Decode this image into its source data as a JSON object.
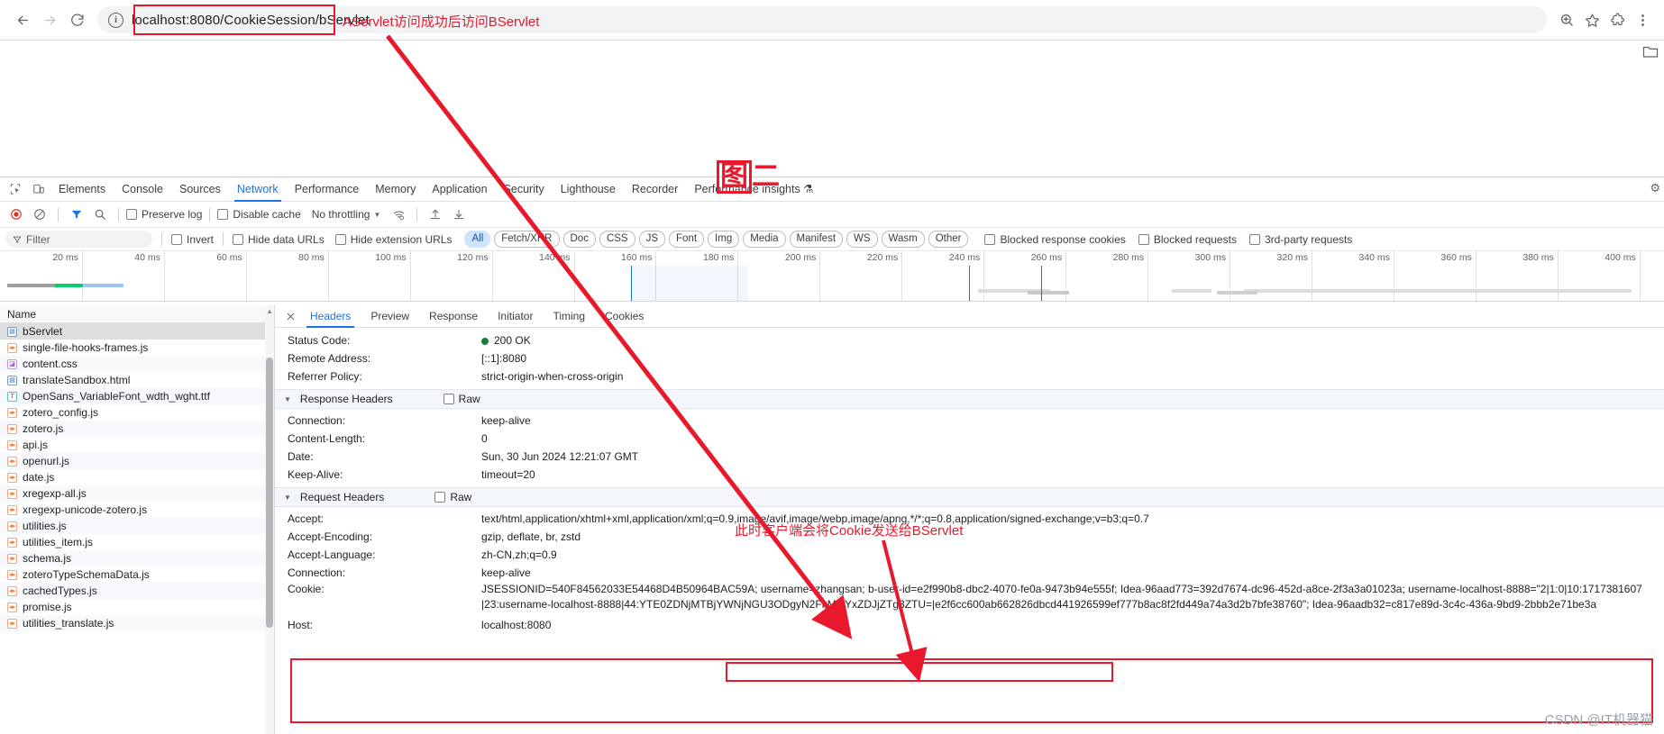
{
  "browser": {
    "url": "localhost:8080/CookieSession/bServlet",
    "nav": {
      "back": "←",
      "forward": "→",
      "reload": "⟳"
    },
    "site_info_icon": "info-icon",
    "zoom_icon": "zoom-icon",
    "bookmark_icon": "star-icon",
    "extensions_icon": "puzzle-icon",
    "menu_icon": "more-icon"
  },
  "annotations": {
    "url_note": "AServlet访问成功后访问BServlet",
    "figure_label_boxed": "图",
    "figure_label_rest": "二",
    "cookie_note": "此时客户端会将Cookie发送给BServlet",
    "red": "#e8192c"
  },
  "devtools": {
    "tabs": [
      {
        "label": "Elements",
        "active": false
      },
      {
        "label": "Console",
        "active": false
      },
      {
        "label": "Sources",
        "active": false
      },
      {
        "label": "Network",
        "active": true
      },
      {
        "label": "Performance",
        "active": false
      },
      {
        "label": "Memory",
        "active": false
      },
      {
        "label": "Application",
        "active": false
      },
      {
        "label": "Security",
        "active": false
      },
      {
        "label": "Lighthouse",
        "active": false
      },
      {
        "label": "Recorder",
        "active": false
      },
      {
        "label": "Performance insights ⚗",
        "active": false
      }
    ],
    "toolbar": {
      "record_icon": "record-icon",
      "clear_icon": "clear-icon",
      "filter_icon": "filter-icon",
      "search_icon": "search-icon",
      "preserve_log": "Preserve log",
      "disable_cache": "Disable cache",
      "throttling": "No throttling",
      "wifi_icon": "network-conditions-icon",
      "import_icon": "import-har-icon",
      "export_icon": "export-har-icon"
    },
    "filter_row": {
      "filter_placeholder": "Filter",
      "invert": "Invert",
      "hide_data_urls": "Hide data URLs",
      "hide_extension_urls": "Hide extension URLs",
      "types": [
        "All",
        "Fetch/XHR",
        "Doc",
        "CSS",
        "JS",
        "Font",
        "Img",
        "Media",
        "Manifest",
        "WS",
        "Wasm",
        "Other"
      ],
      "selected_type": "All",
      "blocked_response_cookies": "Blocked response cookies",
      "blocked_requests": "Blocked requests",
      "third_party_requests": "3rd-party requests"
    },
    "timeline": {
      "ticks": [
        "20 ms",
        "40 ms",
        "60 ms",
        "80 ms",
        "100 ms",
        "120 ms",
        "140 ms",
        "160 ms",
        "180 ms",
        "200 ms",
        "220 ms",
        "240 ms",
        "260 ms",
        "280 ms",
        "300 ms",
        "320 ms",
        "340 ms",
        "360 ms",
        "380 ms",
        "400 ms"
      ]
    },
    "requests": {
      "header": "Name",
      "items": [
        {
          "name": "bServlet",
          "type": "doc",
          "badge": "▤",
          "selected": true
        },
        {
          "name": "single-file-hooks-frames.js",
          "type": "js",
          "badge": "◂▸",
          "selected": false
        },
        {
          "name": "content.css",
          "type": "css",
          "badge": "◪",
          "selected": false
        },
        {
          "name": "translateSandbox.html",
          "type": "doc",
          "badge": "▤",
          "selected": false
        },
        {
          "name": "OpenSans_VariableFont_wdth_wght.ttf",
          "type": "font",
          "badge": "T",
          "selected": false
        },
        {
          "name": "zotero_config.js",
          "type": "js",
          "badge": "◂▸",
          "selected": false
        },
        {
          "name": "zotero.js",
          "type": "js",
          "badge": "◂▸",
          "selected": false
        },
        {
          "name": "api.js",
          "type": "js",
          "badge": "◂▸",
          "selected": false
        },
        {
          "name": "openurl.js",
          "type": "js",
          "badge": "◂▸",
          "selected": false
        },
        {
          "name": "date.js",
          "type": "js",
          "badge": "◂▸",
          "selected": false
        },
        {
          "name": "xregexp-all.js",
          "type": "js",
          "badge": "◂▸",
          "selected": false
        },
        {
          "name": "xregexp-unicode-zotero.js",
          "type": "js",
          "badge": "◂▸",
          "selected": false
        },
        {
          "name": "utilities.js",
          "type": "js",
          "badge": "◂▸",
          "selected": false
        },
        {
          "name": "utilities_item.js",
          "type": "js",
          "badge": "◂▸",
          "selected": false
        },
        {
          "name": "schema.js",
          "type": "js",
          "badge": "◂▸",
          "selected": false
        },
        {
          "name": "zoteroTypeSchemaData.js",
          "type": "js",
          "badge": "◂▸",
          "selected": false
        },
        {
          "name": "cachedTypes.js",
          "type": "js",
          "badge": "◂▸",
          "selected": false
        },
        {
          "name": "promise.js",
          "type": "js",
          "badge": "◂▸",
          "selected": false
        },
        {
          "name": "utilities_translate.js",
          "type": "js",
          "badge": "◂▸",
          "selected": false
        }
      ]
    },
    "detail": {
      "close_icon": "close-icon",
      "tabs": [
        {
          "label": "Headers",
          "active": true
        },
        {
          "label": "Preview",
          "active": false
        },
        {
          "label": "Response",
          "active": false
        },
        {
          "label": "Initiator",
          "active": false
        },
        {
          "label": "Timing",
          "active": false
        },
        {
          "label": "Cookies",
          "active": false
        }
      ],
      "general": [
        {
          "key": "Status Code:",
          "value": "200 OK",
          "dot": true
        },
        {
          "key": "Remote Address:",
          "value": "[::1]:8080",
          "dot": false
        },
        {
          "key": "Referrer Policy:",
          "value": "strict-origin-when-cross-origin",
          "dot": false
        }
      ],
      "response_headers_title": "Response Headers",
      "request_headers_title": "Request Headers",
      "raw_label": "Raw",
      "response_headers": [
        {
          "key": "Connection:",
          "value": "keep-alive"
        },
        {
          "key": "Content-Length:",
          "value": "0"
        },
        {
          "key": "Date:",
          "value": "Sun, 30 Jun 2024 12:21:07 GMT"
        },
        {
          "key": "Keep-Alive:",
          "value": "timeout=20"
        }
      ],
      "request_headers": [
        {
          "key": "Accept:",
          "value": "text/html,application/xhtml+xml,application/xml;q=0.9,image/avif,image/webp,image/apng,*/*;q=0.8,application/signed-exchange;v=b3;q=0.7"
        },
        {
          "key": "Accept-Encoding:",
          "value": "gzip, deflate, br, zstd"
        },
        {
          "key": "Accept-Language:",
          "value": "zh-CN,zh;q=0.9"
        },
        {
          "key": "Connection:",
          "value": "keep-alive"
        }
      ],
      "cookie_key": "Cookie:",
      "cookie_value": "JSESSIONID=540F84562033E54468D4B50964BAC59A; username=zhangsan; b-user-id=e2f990b8-dbc2-4070-fe0a-9473b94e555f; Idea-96aad773=392d7674-dc96-452d-a8ce-2f3a3a01023a; username-localhost-8888=\"2|1:0|10:1717381607|23:username-localhost-8888|44:YTE0ZDNjMTBjYWNjNGU3ODgyN2FkMGYxZDJjZTg3ZTU=|e2f6cc600ab662826dbcd441926599ef777b8ac8f2fd449a74a3d2b7bfe38760\"; Idea-96aadb32=c817e89d-3c4c-436a-9bd9-2bbb2e71be3a",
      "host_key": "Host:",
      "host_value": "localhost:8080"
    }
  },
  "watermark": "CSDN @IT机器猫"
}
